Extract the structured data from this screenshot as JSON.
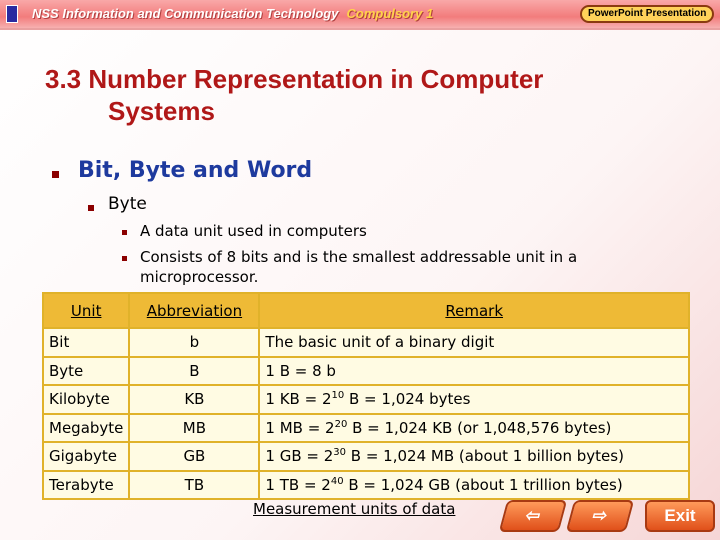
{
  "banner": {
    "title": "NSS Information and Communication Technology",
    "subtitle": "Compulsory 1",
    "badge": "PowerPoint Presentation"
  },
  "title_line1": "3.3  Number Representation in Computer",
  "title_line2": "Systems",
  "heading": "Bit, Byte and Word",
  "subheading": "Byte",
  "points": [
    "A data unit used in computers",
    "Consists of 8 bits and is the smallest addressable unit in a",
    "microprocessor."
  ],
  "table": {
    "headers": [
      "Unit",
      "Abbreviation",
      "Remark"
    ],
    "rows": [
      [
        "Bit",
        "b",
        "The basic unit of a binary digit"
      ],
      [
        "Byte",
        "B",
        "1 B = 8 b"
      ],
      [
        "Kilobyte",
        "KB",
        "1 KB = 2^10 B = 1,024 bytes"
      ],
      [
        "Megabyte",
        "MB",
        "1 MB = 2^20 B = 1,024 KB (or 1,048,576 bytes)"
      ],
      [
        "Gigabyte",
        "GB",
        "1 GB = 2^30 B = 1,024 MB (about 1 billion bytes)"
      ],
      [
        "Terabyte",
        "TB",
        "1 TB = 2^40 B = 1,024 GB (about 1 trillion bytes)"
      ]
    ]
  },
  "caption": "Measurement units of data",
  "nav": {
    "prev": "⇦",
    "next": "⇨",
    "exit": "Exit"
  }
}
